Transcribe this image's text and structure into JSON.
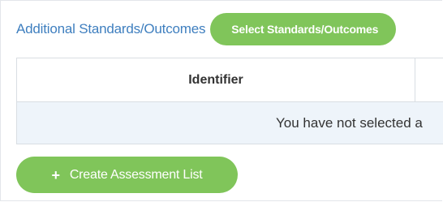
{
  "standards": {
    "title": "Additional Standards/Outcomes",
    "select_button": "Select Standards/Outcomes"
  },
  "table": {
    "columns": [
      "Identifier"
    ],
    "empty_message": "You have not selected a"
  },
  "actions": {
    "create_icon": "+",
    "create_label": "Create Assessment List"
  },
  "colors": {
    "accent_green": "#80c55a",
    "title_blue": "#3f7fbf",
    "row_tint": "#eef4fa"
  }
}
